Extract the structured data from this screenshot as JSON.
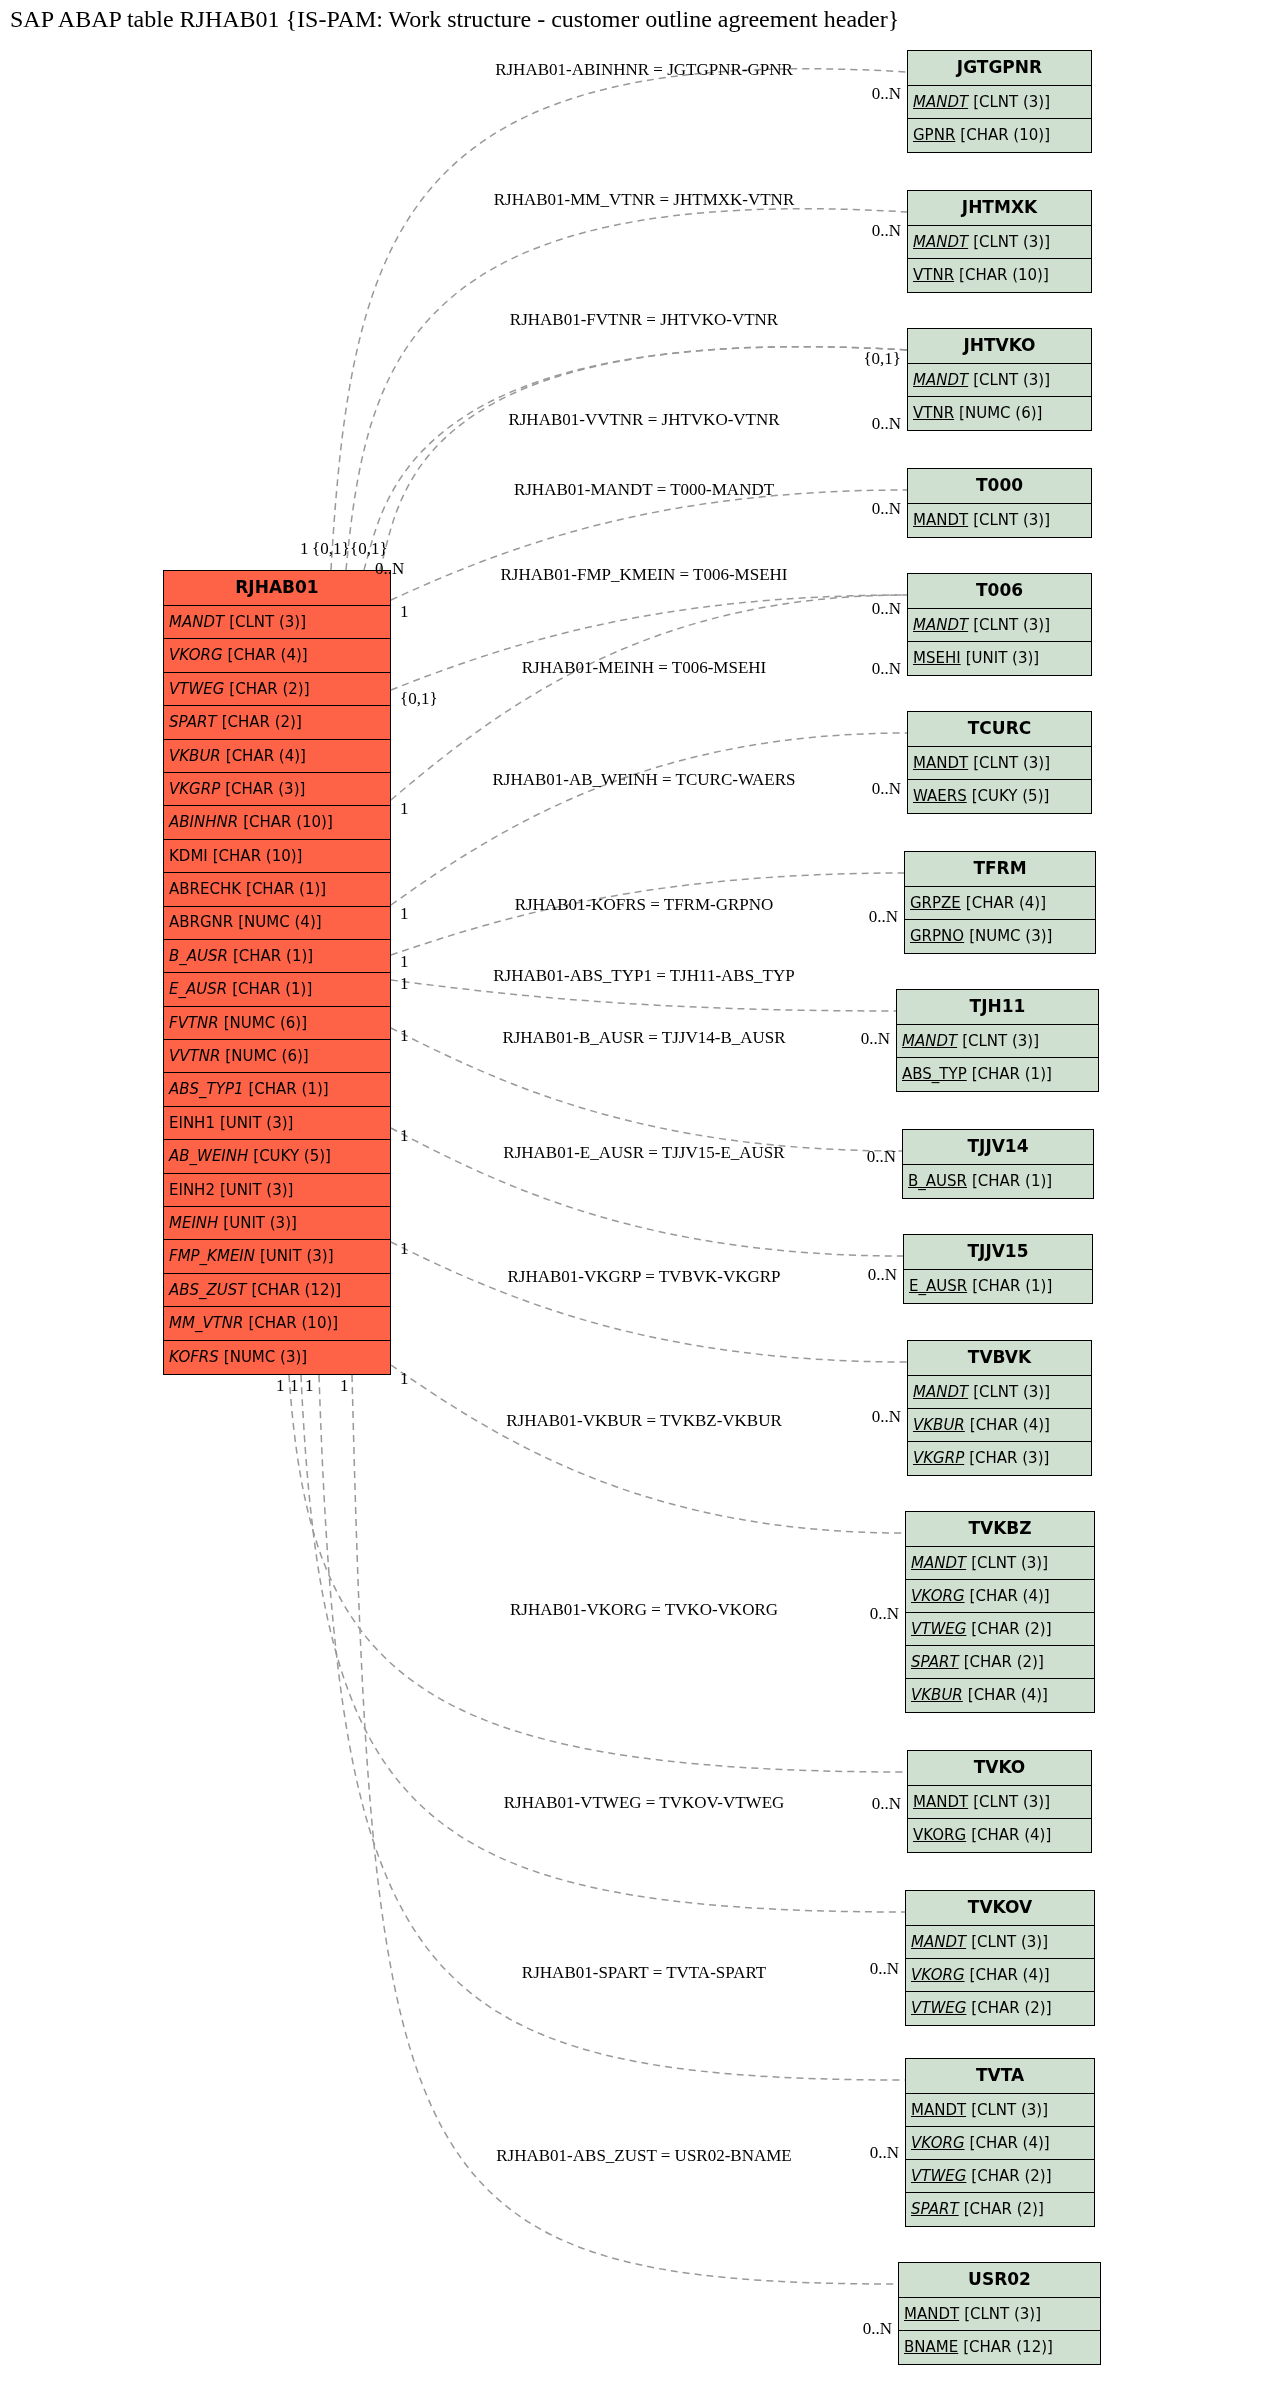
{
  "title": "SAP ABAP table RJHAB01 {IS-PAM: Work structure - customer outline agreement header}",
  "main_table": {
    "name": "RJHAB01",
    "fields": [
      {
        "name": "MANDT",
        "type": "[CLNT (3)]",
        "italic": true
      },
      {
        "name": "VKORG",
        "type": "[CHAR (4)]",
        "italic": true
      },
      {
        "name": "VTWEG",
        "type": "[CHAR (2)]",
        "italic": true
      },
      {
        "name": "SPART",
        "type": "[CHAR (2)]",
        "italic": true
      },
      {
        "name": "VKBUR",
        "type": "[CHAR (4)]",
        "italic": true
      },
      {
        "name": "VKGRP",
        "type": "[CHAR (3)]",
        "italic": true
      },
      {
        "name": "ABINHNR",
        "type": "[CHAR (10)]",
        "italic": true
      },
      {
        "name": "KDMI",
        "type": "[CHAR (10)]",
        "italic": false
      },
      {
        "name": "ABRECHK",
        "type": "[CHAR (1)]",
        "italic": false
      },
      {
        "name": "ABRGNR",
        "type": "[NUMC (4)]",
        "italic": false
      },
      {
        "name": "B_AUSR",
        "type": "[CHAR (1)]",
        "italic": true
      },
      {
        "name": "E_AUSR",
        "type": "[CHAR (1)]",
        "italic": true
      },
      {
        "name": "FVTNR",
        "type": "[NUMC (6)]",
        "italic": true
      },
      {
        "name": "VVTNR",
        "type": "[NUMC (6)]",
        "italic": true
      },
      {
        "name": "ABS_TYP1",
        "type": "[CHAR (1)]",
        "italic": true
      },
      {
        "name": "EINH1",
        "type": "[UNIT (3)]",
        "italic": false
      },
      {
        "name": "AB_WEINH",
        "type": "[CUKY (5)]",
        "italic": true
      },
      {
        "name": "EINH2",
        "type": "[UNIT (3)]",
        "italic": false
      },
      {
        "name": "MEINH",
        "type": "[UNIT (3)]",
        "italic": true
      },
      {
        "name": "FMP_KMEIN",
        "type": "[UNIT (3)]",
        "italic": true
      },
      {
        "name": "ABS_ZUST",
        "type": "[CHAR (12)]",
        "italic": true
      },
      {
        "name": "MM_VTNR",
        "type": "[CHAR (10)]",
        "italic": true
      },
      {
        "name": "KOFRS",
        "type": "[NUMC (3)]",
        "italic": true
      }
    ]
  },
  "tables": [
    {
      "name": "JGTGPNR",
      "fields": [
        {
          "name": "MANDT",
          "type": "[CLNT (3)]",
          "italic": true
        },
        {
          "name": "GPNR",
          "type": "[CHAR (10)]",
          "italic": false
        }
      ]
    },
    {
      "name": "JHTMXK",
      "fields": [
        {
          "name": "MANDT",
          "type": "[CLNT (3)]",
          "italic": true
        },
        {
          "name": "VTNR",
          "type": "[CHAR (10)]",
          "italic": false
        }
      ]
    },
    {
      "name": "JHTVKO",
      "fields": [
        {
          "name": "MANDT",
          "type": "[CLNT (3)]",
          "italic": true
        },
        {
          "name": "VTNR",
          "type": "[NUMC (6)]",
          "italic": false
        }
      ]
    },
    {
      "name": "T000",
      "fields": [
        {
          "name": "MANDT",
          "type": "[CLNT (3)]",
          "italic": false
        }
      ]
    },
    {
      "name": "T006",
      "fields": [
        {
          "name": "MANDT",
          "type": "[CLNT (3)]",
          "italic": true
        },
        {
          "name": "MSEHI",
          "type": "[UNIT (3)]",
          "italic": false
        }
      ]
    },
    {
      "name": "TCURC",
      "fields": [
        {
          "name": "MANDT",
          "type": "[CLNT (3)]",
          "italic": false
        },
        {
          "name": "WAERS",
          "type": "[CUKY (5)]",
          "italic": false
        }
      ]
    },
    {
      "name": "TFRM",
      "fields": [
        {
          "name": "GRPZE",
          "type": "[CHAR (4)]",
          "italic": false
        },
        {
          "name": "GRPNO",
          "type": "[NUMC (3)]",
          "italic": false
        }
      ]
    },
    {
      "name": "TJH11",
      "fields": [
        {
          "name": "MANDT",
          "type": "[CLNT (3)]",
          "italic": true
        },
        {
          "name": "ABS_TYP",
          "type": "[CHAR (1)]",
          "italic": false
        }
      ]
    },
    {
      "name": "TJJV14",
      "fields": [
        {
          "name": "B_AUSR",
          "type": "[CHAR (1)]",
          "italic": false
        }
      ]
    },
    {
      "name": "TJJV15",
      "fields": [
        {
          "name": "E_AUSR",
          "type": "[CHAR (1)]",
          "italic": false
        }
      ]
    },
    {
      "name": "TVBVK",
      "fields": [
        {
          "name": "MANDT",
          "type": "[CLNT (3)]",
          "italic": true
        },
        {
          "name": "VKBUR",
          "type": "[CHAR (4)]",
          "italic": true
        },
        {
          "name": "VKGRP",
          "type": "[CHAR (3)]",
          "italic": true
        }
      ]
    },
    {
      "name": "TVKBZ",
      "fields": [
        {
          "name": "MANDT",
          "type": "[CLNT (3)]",
          "italic": true
        },
        {
          "name": "VKORG",
          "type": "[CHAR (4)]",
          "italic": true
        },
        {
          "name": "VTWEG",
          "type": "[CHAR (2)]",
          "italic": true
        },
        {
          "name": "SPART",
          "type": "[CHAR (2)]",
          "italic": true
        },
        {
          "name": "VKBUR",
          "type": "[CHAR (4)]",
          "italic": true
        }
      ]
    },
    {
      "name": "TVKO",
      "fields": [
        {
          "name": "MANDT",
          "type": "[CLNT (3)]",
          "italic": false
        },
        {
          "name": "VKORG",
          "type": "[CHAR (4)]",
          "italic": false
        }
      ]
    },
    {
      "name": "TVKOV",
      "fields": [
        {
          "name": "MANDT",
          "type": "[CLNT (3)]",
          "italic": true
        },
        {
          "name": "VKORG",
          "type": "[CHAR (4)]",
          "italic": true
        },
        {
          "name": "VTWEG",
          "type": "[CHAR (2)]",
          "italic": true
        }
      ]
    },
    {
      "name": "TVTA",
      "fields": [
        {
          "name": "MANDT",
          "type": "[CLNT (3)]",
          "italic": false
        },
        {
          "name": "VKORG",
          "type": "[CHAR (4)]",
          "italic": true
        },
        {
          "name": "VTWEG",
          "type": "[CHAR (2)]",
          "italic": true
        },
        {
          "name": "SPART",
          "type": "[CHAR (2)]",
          "italic": true
        }
      ]
    },
    {
      "name": "USR02",
      "fields": [
        {
          "name": "MANDT",
          "type": "[CLNT (3)]",
          "italic": false
        },
        {
          "name": "BNAME",
          "type": "[CHAR (12)]",
          "italic": false
        }
      ]
    }
  ],
  "relations": [
    {
      "label": "RJHAB01-ABINHNR = JGTGPNR-GPNR",
      "from_card": "1",
      "to_card": "0..N"
    },
    {
      "label": "RJHAB01-MM_VTNR = JHTMXK-VTNR",
      "from_card": "{0,1}",
      "to_card": "0..N"
    },
    {
      "label": "RJHAB01-FVTNR = JHTVKO-VTNR",
      "from_card": "{0,1}",
      "to_card": "{0,1}"
    },
    {
      "label": "RJHAB01-VVTNR = JHTVKO-VTNR",
      "from_card": "0..N",
      "to_card": "0..N"
    },
    {
      "label": "RJHAB01-MANDT = T000-MANDT",
      "from_card": "1",
      "to_card": "0..N"
    },
    {
      "label": "RJHAB01-FMP_KMEIN = T006-MSEHI",
      "from_card": "{0,1}",
      "to_card": "0..N"
    },
    {
      "label": "RJHAB01-MEINH = T006-MSEHI",
      "from_card": "1",
      "to_card": "0..N"
    },
    {
      "label": "RJHAB01-AB_WEINH = TCURC-WAERS",
      "from_card": "1",
      "to_card": "0..N"
    },
    {
      "label": "RJHAB01-KOFRS = TFRM-GRPNO",
      "from_card": "1",
      "to_card": "0..N"
    },
    {
      "label": "RJHAB01-ABS_TYP1 = TJH11-ABS_TYP",
      "from_card": "1",
      "to_card": "0..N"
    },
    {
      "label": "RJHAB01-B_AUSR = TJJV14-B_AUSR",
      "from_card": "1",
      "to_card": "0..N"
    },
    {
      "label": "RJHAB01-E_AUSR = TJJV15-E_AUSR",
      "from_card": "1",
      "to_card": "0..N"
    },
    {
      "label": "RJHAB01-VKGRP = TVBVK-VKGRP",
      "from_card": "1",
      "to_card": "0..N"
    },
    {
      "label": "RJHAB01-VKBUR = TVKBZ-VKBUR",
      "from_card": "1",
      "to_card": "0..N"
    },
    {
      "label": "RJHAB01-VKORG = TVKO-VKORG",
      "from_card": "1",
      "to_card": "0..N"
    },
    {
      "label": "RJHAB01-VTWEG = TVKOV-VTWEG",
      "from_card": "1",
      "to_card": "0..N"
    },
    {
      "label": "RJHAB01-SPART = TVTA-SPART",
      "from_card": "1",
      "to_card": "0..N"
    },
    {
      "label": "RJHAB01-ABS_ZUST = USR02-BNAME",
      "from_card": "1",
      "to_card": "0..N"
    }
  ]
}
